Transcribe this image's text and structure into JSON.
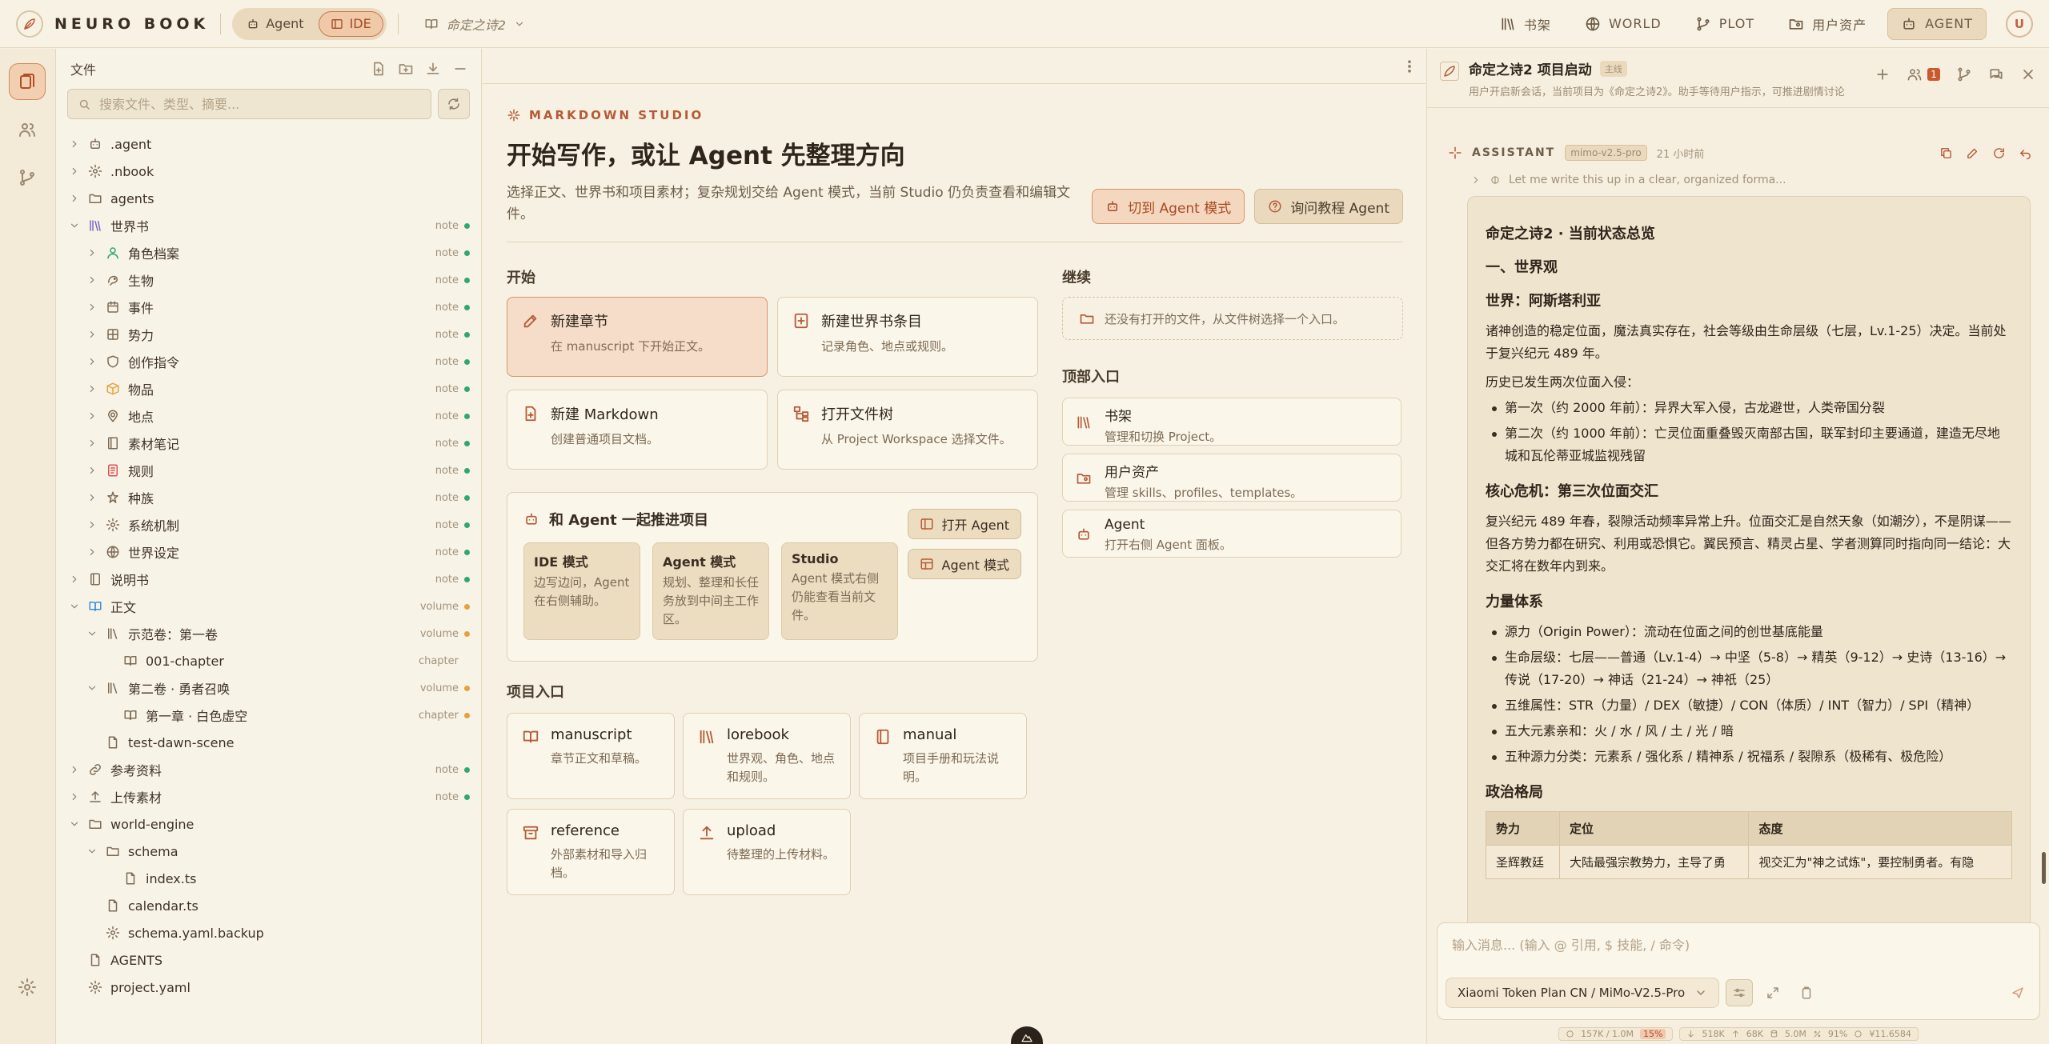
{
  "topbar": {
    "brand": "NEURO BOOK",
    "modes": [
      {
        "label": "Agent",
        "icon": "robot-icon",
        "active": false
      },
      {
        "label": "IDE",
        "icon": "ide-icon",
        "active": true
      }
    ],
    "book": "命定之诗2",
    "nav": [
      {
        "label": "书架",
        "icon": "library-icon"
      },
      {
        "label": "WORLD",
        "icon": "globe-icon"
      },
      {
        "label": "PLOT",
        "icon": "branch-icon"
      },
      {
        "label": "用户资产",
        "icon": "folder-user-icon"
      },
      {
        "label": "AGENT",
        "icon": "robot-icon",
        "active": true
      }
    ],
    "avatar": "U"
  },
  "sidebar": {
    "title": "文件",
    "search_placeholder": "搜索文件、类型、摘要...",
    "tree": [
      {
        "label": ".agent",
        "level": 0,
        "chevron": "right",
        "icon": "robot-icon"
      },
      {
        "label": ".nbook",
        "level": 0,
        "chevron": "right",
        "icon": "gear-icon"
      },
      {
        "label": "agents",
        "level": 0,
        "chevron": "right",
        "icon": "folder-icon"
      },
      {
        "label": "世界书",
        "level": 0,
        "chevron": "down",
        "icon": "library-icon",
        "tag": "note",
        "dot": "green"
      },
      {
        "label": "角色档案",
        "level": 1,
        "chevron": "right",
        "icon": "person-icon",
        "tag": "note",
        "dot": "green"
      },
      {
        "label": "生物",
        "level": 1,
        "chevron": "right",
        "icon": "creature-icon",
        "tag": "note",
        "dot": "green"
      },
      {
        "label": "事件",
        "level": 1,
        "chevron": "right",
        "icon": "calendar-icon",
        "tag": "note",
        "dot": "green"
      },
      {
        "label": "势力",
        "level": 1,
        "chevron": "right",
        "icon": "faction-icon",
        "tag": "note",
        "dot": "green"
      },
      {
        "label": "创作指令",
        "level": 1,
        "chevron": "right",
        "icon": "shield-icon",
        "tag": "note",
        "dot": "green"
      },
      {
        "label": "物品",
        "level": 1,
        "chevron": "right",
        "icon": "box-icon",
        "tag": "note",
        "dot": "green"
      },
      {
        "label": "地点",
        "level": 1,
        "chevron": "right",
        "icon": "location-icon",
        "tag": "note",
        "dot": "green"
      },
      {
        "label": "素材笔记",
        "level": 1,
        "chevron": "right",
        "icon": "notebook-icon",
        "tag": "note",
        "dot": "green"
      },
      {
        "label": "规则",
        "level": 1,
        "chevron": "right",
        "icon": "rules-icon",
        "tag": "note",
        "dot": "green"
      },
      {
        "label": "种族",
        "level": 1,
        "chevron": "right",
        "icon": "race-icon",
        "tag": "note",
        "dot": "green"
      },
      {
        "label": "系统机制",
        "level": 1,
        "chevron": "right",
        "icon": "gear-icon",
        "tag": "note",
        "dot": "green"
      },
      {
        "label": "世界设定",
        "level": 1,
        "chevron": "right",
        "icon": "globe-icon",
        "tag": "note",
        "dot": "green"
      },
      {
        "label": "说明书",
        "level": 0,
        "chevron": "right",
        "icon": "manual-icon",
        "tag": "note",
        "dot": "green"
      },
      {
        "label": "正文",
        "level": 0,
        "chevron": "down",
        "icon": "book-open-icon",
        "tag": "volume",
        "dot": "orange"
      },
      {
        "label": "示范卷：第一卷",
        "level": 1,
        "chevron": "down",
        "icon": "volume-icon",
        "tag": "volume",
        "dot": "orange"
      },
      {
        "label": "001-chapter",
        "level": 2,
        "chevron": "none",
        "icon": "chapter-icon",
        "tag": "chapter"
      },
      {
        "label": "第二卷 · 勇者召唤",
        "level": 1,
        "chevron": "down",
        "icon": "volume-icon",
        "tag": "volume",
        "dot": "orange"
      },
      {
        "label": "第一章 · 白色虚空",
        "level": 2,
        "chevron": "none",
        "icon": "chapter-icon",
        "tag": "chapter",
        "dot": "orange"
      },
      {
        "label": "test-dawn-scene",
        "level": 1,
        "chevron": "none",
        "icon": "file-icon"
      },
      {
        "label": "参考资料",
        "level": 0,
        "chevron": "right",
        "icon": "link-icon",
        "tag": "note",
        "dot": "green"
      },
      {
        "label": "上传素材",
        "level": 0,
        "chevron": "right",
        "icon": "upload-icon",
        "tag": "note",
        "dot": "green"
      },
      {
        "label": "world-engine",
        "level": 0,
        "chevron": "down",
        "icon": "folder-icon"
      },
      {
        "label": "schema",
        "level": 1,
        "chevron": "down",
        "icon": "folder-icon"
      },
      {
        "label": "index.ts",
        "level": 2,
        "chevron": "none",
        "icon": "file-icon"
      },
      {
        "label": "calendar.ts",
        "level": 1,
        "chevron": "none",
        "icon": "file-icon"
      },
      {
        "label": "schema.yaml.backup",
        "level": 1,
        "chevron": "none",
        "icon": "gear-icon"
      },
      {
        "label": "AGENTS",
        "level": 0,
        "chevron": "none",
        "icon": "file-icon"
      },
      {
        "label": "project.yaml",
        "level": 0,
        "chevron": "none",
        "icon": "gear-icon"
      }
    ]
  },
  "studio": {
    "kicker": "MARKDOWN STUDIO",
    "title": "开始写作，或让 Agent 先整理方向",
    "subtitle": "选择正文、世界书和项目素材；复杂规划交给 Agent 模式，当前 Studio 仍负责查看和编辑文件。",
    "btn_agent": "切到 Agent 模式",
    "btn_help": "询问教程 Agent",
    "start_title": "开始",
    "start_cards": [
      {
        "title": "新建章节",
        "desc": "在 manuscript 下开始正文。",
        "icon": "pen-icon",
        "primary": true
      },
      {
        "title": "新建世界书条目",
        "desc": "记录角色、地点或规则。",
        "icon": "add-entry-icon"
      },
      {
        "title": "新建 Markdown",
        "desc": "创建普通项目文档。",
        "icon": "new-file-icon"
      },
      {
        "title": "打开文件树",
        "desc": "从 Project Workspace 选择文件。",
        "icon": "tree-icon"
      }
    ],
    "continue_title": "继续",
    "continue_empty": "还没有打开的文件，从文件树选择一个入口。",
    "toplinks_title": "顶部入口",
    "toplinks": [
      {
        "title": "书架",
        "desc": "管理和切换 Project。",
        "icon": "library-icon"
      },
      {
        "title": "用户资产",
        "desc": "管理 skills、profiles、templates。",
        "icon": "folder-user-icon"
      },
      {
        "title": "Agent",
        "desc": "打开右侧 Agent 面板。",
        "icon": "robot-icon"
      }
    ],
    "joint": {
      "title": "和 Agent 一起推进项目",
      "modes": [
        {
          "title": "IDE 模式",
          "desc": "边写边问，Agent 在右侧辅助。"
        },
        {
          "title": "Agent 模式",
          "desc": "规划、整理和长任务放到中间主工作区。"
        },
        {
          "title": "Studio",
          "desc": "Agent 模式右侧仍能查看当前文件。"
        }
      ],
      "btn_open": "打开 Agent",
      "btn_mode": "Agent 模式"
    },
    "project_title": "项目入口",
    "project_cards": [
      {
        "title": "manuscript",
        "desc": "章节正文和草稿。",
        "icon": "book-open-icon"
      },
      {
        "title": "lorebook",
        "desc": "世界观、角色、地点和规则。",
        "icon": "library-icon"
      },
      {
        "title": "manual",
        "desc": "项目手册和玩法说明。",
        "icon": "manual-icon"
      },
      {
        "title": "reference",
        "desc": "外部素材和导入归档。",
        "icon": "archive-icon"
      },
      {
        "title": "upload",
        "desc": "待整理的上传材料。",
        "icon": "upload-icon"
      }
    ]
  },
  "agent_panel": {
    "title": "命定之诗2 项目启动",
    "badge": "主线",
    "subtitle": "用户开启新会话，当前项目为《命定之诗2》。助手等待用户指示，可推进剧情讨论···",
    "count": "1",
    "role": "ASSISTANT",
    "model": "mimo-v2.5-pro",
    "time": "21 小时前",
    "thinking": "Let me write this up in a clear, organized forma...",
    "message": {
      "h_title": "命定之诗2 · 当前状态总览",
      "h_world": "一、世界观",
      "h_world_name": "世界：阿斯塔利亚",
      "p1": "诸神创造的稳定位面，魔法真实存在，社会等级由生命层级（七层，Lv.1-25）决定。当前处于复兴纪元 489 年。",
      "p2": "历史已发生两次位面入侵：",
      "invasions": [
        "第一次（约 2000 年前）：异界大军入侵，古龙避世，人类帝国分裂",
        "第二次（约 1000 年前）：亡灵位面重叠毁灭南部古国，联军封印主要通道，建造无尽地城和瓦伦蒂亚城监视残留"
      ],
      "h_crisis": "核心危机：第三次位面交汇",
      "p_crisis": "复兴纪元 489 年春，裂隙活动频率异常上升。位面交汇是自然天象（如潮汐），不是阴谋——但各方势力都在研究、利用或恐惧它。翼民预言、精灵占星、学者测算同时指向同一结论：大交汇将在数年内到来。",
      "h_power": "力量体系",
      "power": [
        "源力（Origin Power）：流动在位面之间的创世基底能量",
        "生命层级：七层——普通（Lv.1-4）→ 中坚（5-8）→ 精英（9-12）→ 史诗（13-16）→ 传说（17-20）→ 神话（21-24）→ 神祇（25）",
        "五维属性：STR（力量）/ DEX（敏捷）/ CON（体质）/ INT（智力）/ SPI（精神）",
        "五大元素亲和：火 / 水 / 风 / 土 / 光 / 暗",
        "五种源力分类：元素系 / 强化系 / 精神系 / 祝福系 / 裂隙系（极稀有、极危险）"
      ],
      "h_politics": "政治格局",
      "table_headers": [
        "势力",
        "定位",
        "态度"
      ],
      "table_rows": [
        [
          "圣辉教廷",
          "大陆最强宗教势力，主导了勇",
          "视交汇为\"神之试炼\"，要控制勇者。有隐"
        ]
      ]
    },
    "input_placeholder": "输入消息... (输入 @ 引用, $ 技能, / 命令)",
    "model_select": "Xiaomi Token Plan CN / MiMo-V2.5-Pro",
    "stats": {
      "context": "157K / 1.0M",
      "context_pct": "15%",
      "down": "518K",
      "up": "68K",
      "cache": "5.0M",
      "hit": "91%",
      "cost": "¥11.6584"
    }
  },
  "colors": {
    "accent": "#b55a36",
    "note_dot": "#2ea870",
    "volume_dot": "#e8a03a",
    "bg": "#f7f1e3"
  }
}
